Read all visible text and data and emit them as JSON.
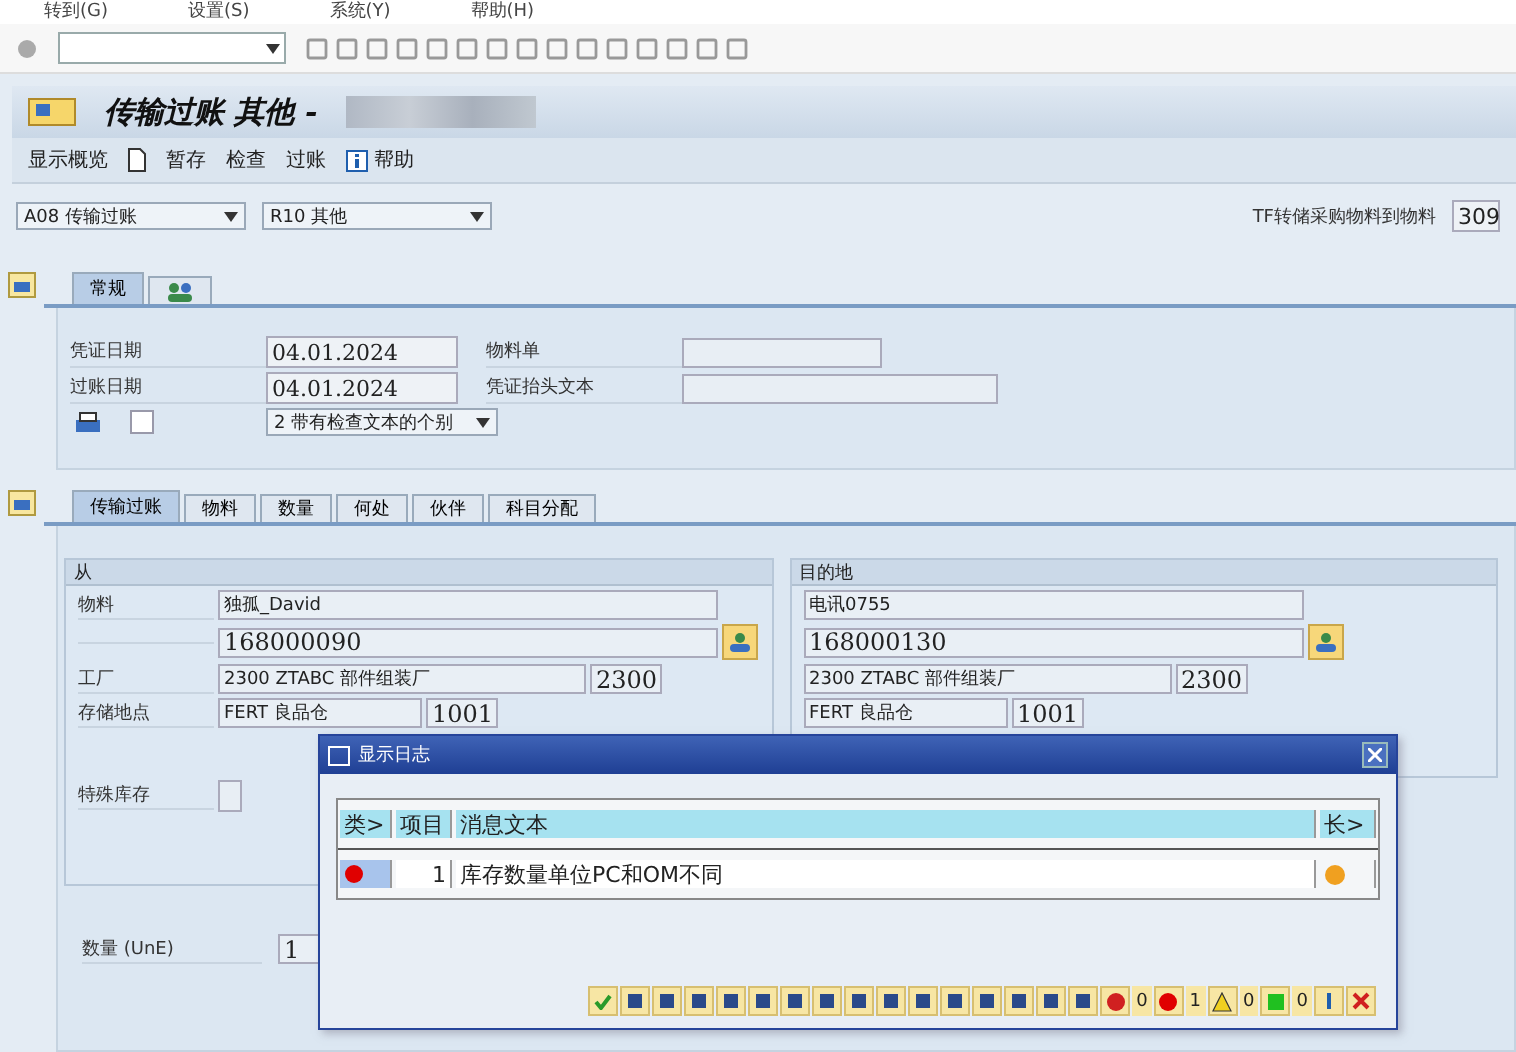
{
  "menu": [
    "转到(G)",
    "设置(S)",
    "系统(Y)",
    "帮助(H)"
  ],
  "title": "传输过账 其他 -",
  "app_toolbar": [
    {
      "kind": "text",
      "label": "显示概览"
    },
    {
      "kind": "document"
    },
    {
      "kind": "text",
      "label": "暂存"
    },
    {
      "kind": "text",
      "label": "检查"
    },
    {
      "kind": "text",
      "label": "过账"
    },
    {
      "kind": "info",
      "label": "帮助"
    }
  ],
  "header": {
    "action": "A08 传输过账",
    "reference": "R10 其他",
    "movement_label": "TF转储采购物料到物料",
    "movement_type": "309"
  },
  "header_tabs": [
    {
      "kind": "text",
      "label": "常规",
      "selected": true
    },
    {
      "kind": "people",
      "selected": false
    }
  ],
  "general": {
    "doc_date_label": "凭证日期",
    "doc_date": "04.01.2024",
    "posting_date_label": "过账日期",
    "posting_date": "04.01.2024",
    "slip_label": "物料单",
    "header_text_label": "凭证抬头文本",
    "print_checked": false,
    "print_option": "2 带有检查文本的个别"
  },
  "item_tabs": [
    {
      "label": "传输过账",
      "selected": true
    },
    {
      "label": "物料",
      "selected": false
    },
    {
      "label": "数量",
      "selected": false
    },
    {
      "label": "何处",
      "selected": false
    },
    {
      "label": "伙伴",
      "selected": false
    },
    {
      "label": "科目分配",
      "selected": false
    }
  ],
  "from": {
    "title": "从",
    "material_label": "物料",
    "material_text": "独孤_David",
    "material": "168000090",
    "plant_label": "工厂",
    "plant_text": "2300 ZTABC 部件组装厂",
    "plant": "2300",
    "sloc_label": "存储地点",
    "sloc_text": "FERT 良品仓",
    "sloc": "1001",
    "special_label": "特殊库存"
  },
  "to": {
    "title": "目的地",
    "material_text": "电讯0755",
    "material": "168000130",
    "plant_text": "2300 ZTABC 部件组装厂",
    "plant": "2300",
    "sloc_text": "FERT 良品仓",
    "sloc": "1001"
  },
  "quantity": {
    "label": "数量 (UnE)",
    "value": "1"
  },
  "dialog": {
    "title": "显示日志",
    "columns": [
      "类>",
      "项目",
      "消息文本",
      "长>"
    ],
    "rows": [
      {
        "color": "#e00000",
        "item": "1",
        "text": "库存数量单位PC和OM不同"
      }
    ],
    "counts": {
      "stop": "0",
      "error": "1",
      "warning": "0",
      "success": "0"
    }
  }
}
